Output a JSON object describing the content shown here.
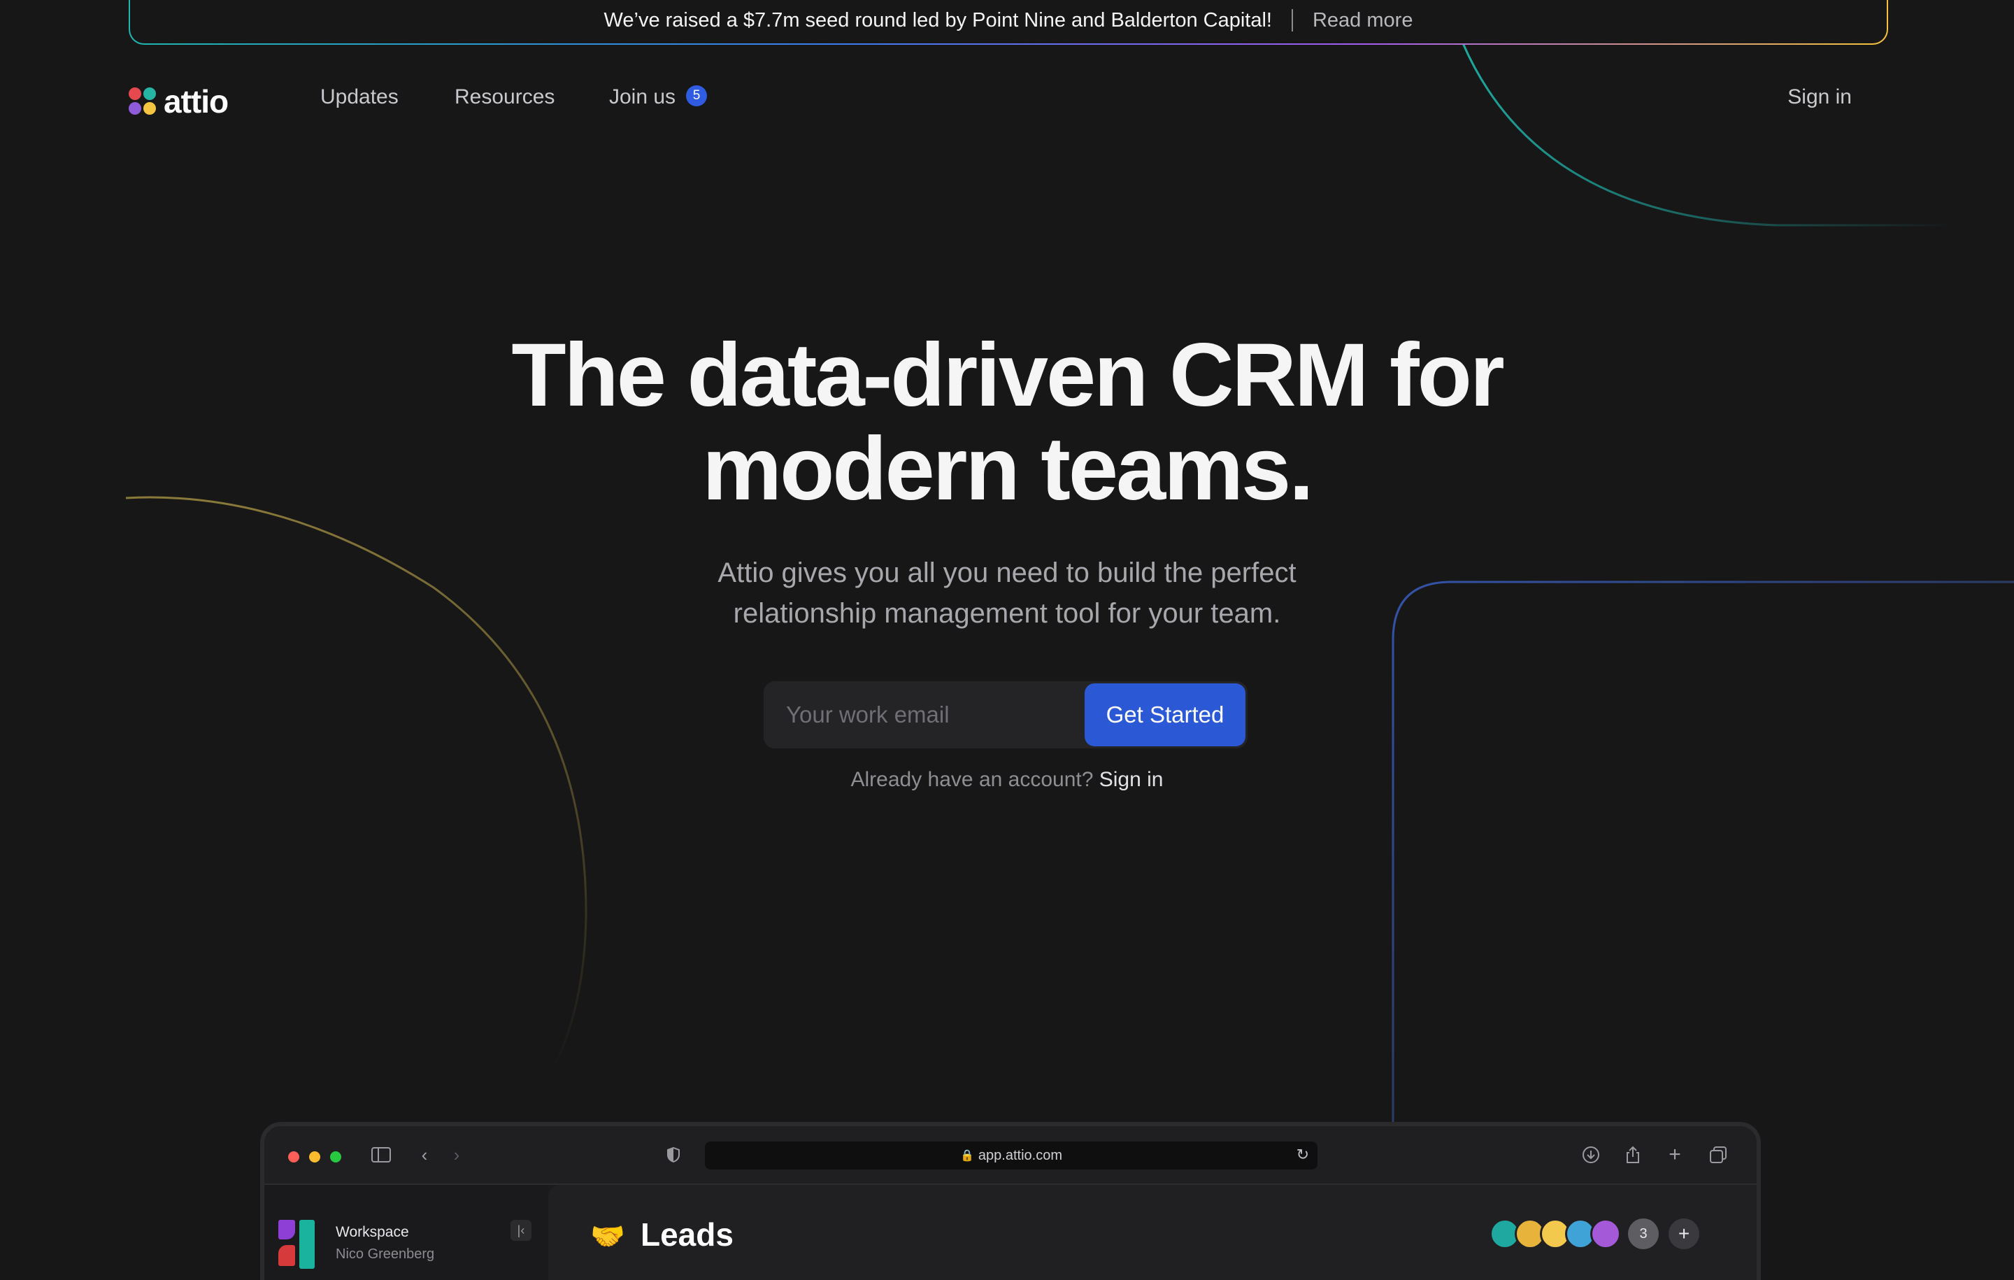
{
  "banner": {
    "message": "We’ve raised a $7.7m seed round led by Point Nine and Balderton Capital!",
    "link": "Read more"
  },
  "nav": {
    "logo": "attio",
    "items": [
      {
        "label": "Updates"
      },
      {
        "label": "Resources"
      },
      {
        "label": "Join us",
        "badge": "5"
      }
    ],
    "sign_in": "Sign in"
  },
  "hero": {
    "title_line1": "The data-driven CRM for",
    "title_line2": "modern teams.",
    "subtitle_line1": "Attio gives you all you need to build the perfect",
    "subtitle_line2": "relationship management tool for your team.",
    "email_placeholder": "Your work email",
    "cta": "Get Started",
    "account_text": "Already have an account?",
    "account_link": "Sign in"
  },
  "browser": {
    "url": "app.attio.com",
    "workspace": "Workspace",
    "user": "Nico Greenberg",
    "page_title": "Leads",
    "collaborator_count": "3"
  },
  "colors": {
    "background": "#171718",
    "primary": "#2b59d6",
    "badge": "#2f5ce0"
  }
}
